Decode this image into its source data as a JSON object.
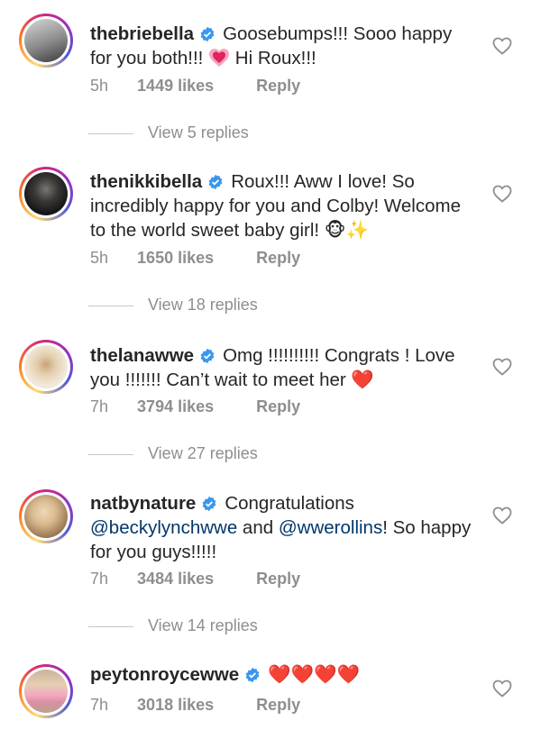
{
  "comments": [
    {
      "username": "thebriebella",
      "text_parts": [
        "Goosebumps!!! Sooo happy for you both!!! ",
        "💗",
        " Hi Roux!!!"
      ],
      "time": "5h",
      "likes": "1449 likes",
      "reply": "Reply",
      "view_replies": "View 5 replies",
      "avatar_colors": [
        "#9a9a9a",
        "#3a3a3a"
      ]
    },
    {
      "username": "thenikkibella",
      "text": "Roux!!! Aww I love! So incredibly happy for you and Colby! Welcome to the world sweet baby girl! 🐵✨",
      "time": "5h",
      "likes": "1650 likes",
      "reply": "Reply",
      "view_replies": "View 18 replies",
      "avatar_colors": [
        "#2b2b2b",
        "#c7c2b8"
      ]
    },
    {
      "username": "thelanawwe",
      "text": "Omg !!!!!!!!!! Congrats ! Love you !!!!!!! Can’t wait to meet her ❤️",
      "time": "7h",
      "likes": "3794 likes",
      "reply": "Reply",
      "view_replies": "View 27 replies",
      "avatar_colors": [
        "#e9dcc9",
        "#c9a97e"
      ]
    },
    {
      "username": "natbynature",
      "text_parts": [
        "Congratulations ",
        "@beckylynchwwe",
        " and ",
        "@wwerollins",
        "! So happy for you guys!!!!!"
      ],
      "time": "7h",
      "likes": "3484 likes",
      "reply": "Reply",
      "view_replies": "View 14 replies",
      "avatar_colors": [
        "#d9c9a8",
        "#b08a61"
      ]
    },
    {
      "username": "peytonroycewwe",
      "text": "❤️❤️❤️❤️",
      "time": "7h",
      "likes": "3018 likes",
      "reply": "Reply",
      "avatar_colors": [
        "#d6c2a8",
        "#e59bb0"
      ]
    }
  ],
  "colors": {
    "text": "#262626",
    "secondary": "#8e8e8e",
    "mention": "#00376b",
    "verified": "#3897f0",
    "heart_red": "#ed1c3e"
  },
  "icons": {
    "verified": "verified-badge-icon",
    "like": "heart-outline-icon",
    "red_heart": "red-heart-icon"
  }
}
